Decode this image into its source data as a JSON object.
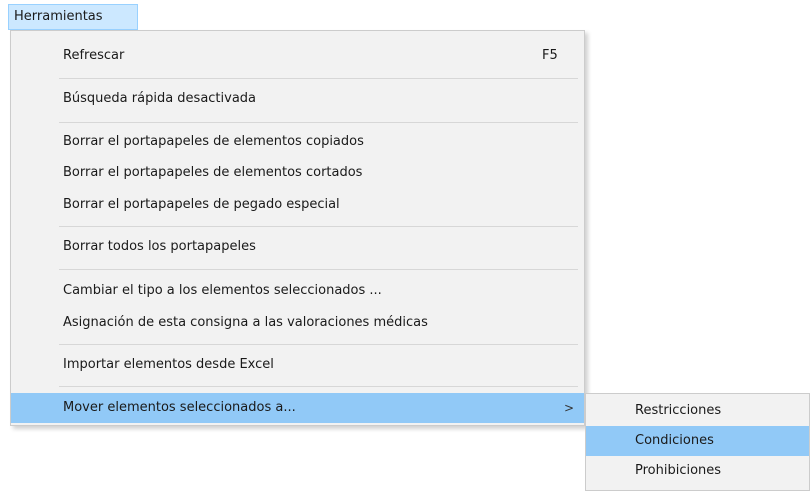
{
  "menubar": {
    "active_menu": "Herramientas"
  },
  "menu": {
    "items": [
      {
        "label": "Refrescar",
        "shortcut": "F5"
      },
      {
        "label": "Búsqueda rápida desactivada"
      },
      {
        "label": "Borrar el portapapeles de elementos copiados"
      },
      {
        "label": "Borrar el portapapeles de elementos cortados"
      },
      {
        "label": "Borrar el portapapeles de pegado especial"
      },
      {
        "label": "Borrar todos los portapapeles"
      },
      {
        "label": "Cambiar el tipo a los elementos seleccionados ..."
      },
      {
        "label": "Asignación de esta consigna a las valoraciones médicas"
      },
      {
        "label": "Importar elementos desde Excel"
      },
      {
        "label": "Mover elementos seleccionados a...",
        "submenu_arrow": ">"
      }
    ]
  },
  "submenu": {
    "items": [
      {
        "label": "Restricciones"
      },
      {
        "label": "Condiciones"
      },
      {
        "label": "Prohibiciones"
      }
    ]
  },
  "colors": {
    "highlight": "#91c9f7",
    "menu_background": "#f2f2f2",
    "menubar_active": "#cce8ff"
  },
  "icons": {
    "submenu_arrow": "chevron-right-icon"
  }
}
